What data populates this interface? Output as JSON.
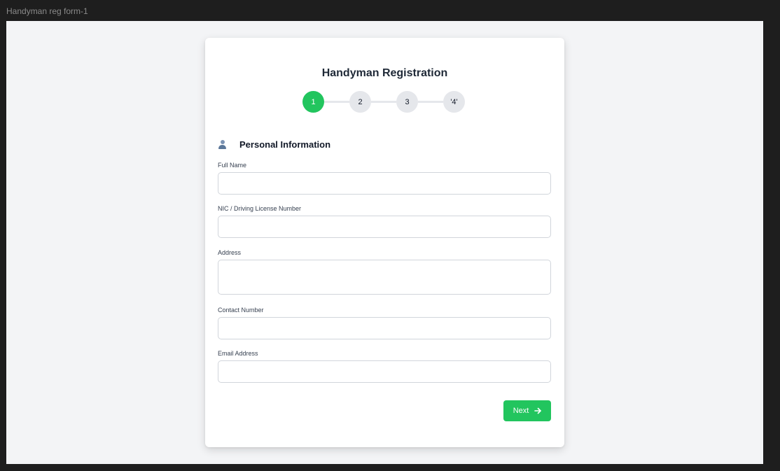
{
  "frame": {
    "label": "Handyman reg form-1"
  },
  "form": {
    "title": "Handyman Registration",
    "steps": [
      "1",
      "2",
      "3",
      "'4'"
    ],
    "active_step": 1,
    "section": {
      "title": "Personal Information",
      "icon": "user-icon"
    },
    "fields": {
      "full_name": {
        "label": "Full Name",
        "value": "",
        "placeholder": ""
      },
      "nic": {
        "label": "NIC / Driving License Number",
        "value": "",
        "placeholder": ""
      },
      "address": {
        "label": "Address",
        "value": "",
        "placeholder": ""
      },
      "contact": {
        "label": "Contact Number",
        "value": "",
        "placeholder": ""
      },
      "email": {
        "label": "Email Address",
        "value": "",
        "placeholder": ""
      }
    },
    "next_button": {
      "label": "Next",
      "icon": "arrow-right-icon"
    }
  },
  "colors": {
    "accent": "#22c55e",
    "canvas_background": "#f3f4f6",
    "step_inactive": "#e5e7eb"
  }
}
